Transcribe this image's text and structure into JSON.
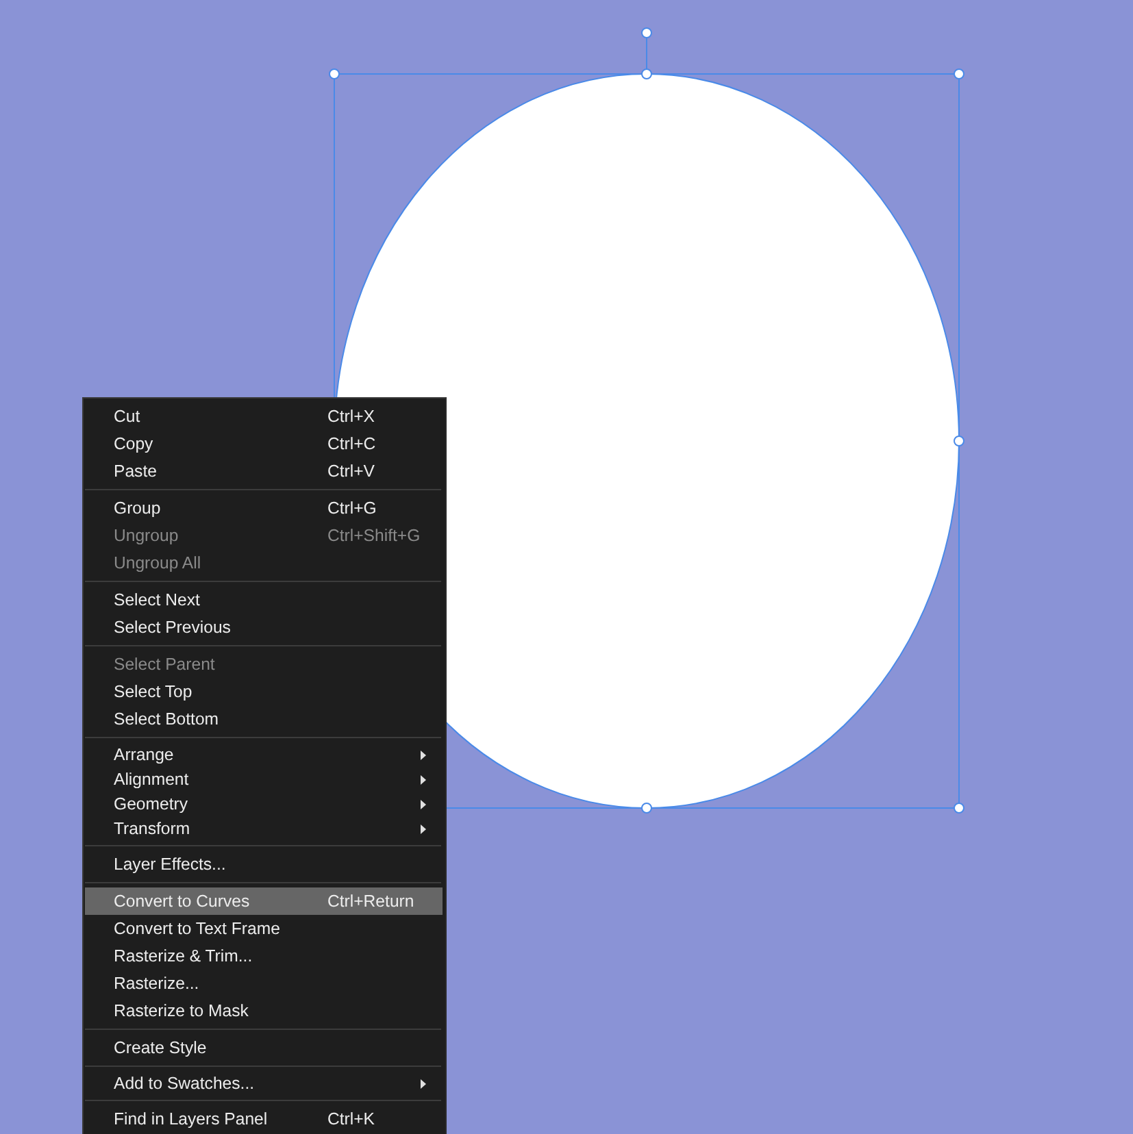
{
  "context_menu": {
    "sections": [
      {
        "items": [
          {
            "kind": "command",
            "label": "Cut",
            "shortcut": "Ctrl+X",
            "disabled": false,
            "selected": false
          },
          {
            "kind": "command",
            "label": "Copy",
            "shortcut": "Ctrl+C",
            "disabled": false,
            "selected": false
          },
          {
            "kind": "command",
            "label": "Paste",
            "shortcut": "Ctrl+V",
            "disabled": false,
            "selected": false
          }
        ]
      },
      {
        "items": [
          {
            "kind": "command",
            "label": "Group",
            "shortcut": "Ctrl+G",
            "disabled": false,
            "selected": false
          },
          {
            "kind": "command",
            "label": "Ungroup",
            "shortcut": "Ctrl+Shift+G",
            "disabled": true,
            "selected": false
          },
          {
            "kind": "command",
            "label": "Ungroup All",
            "disabled": true,
            "selected": false
          }
        ]
      },
      {
        "items": [
          {
            "kind": "command",
            "label": "Select Next",
            "disabled": false,
            "selected": false
          },
          {
            "kind": "command",
            "label": "Select Previous",
            "disabled": false,
            "selected": false
          }
        ]
      },
      {
        "items": [
          {
            "kind": "command",
            "label": "Select Parent",
            "disabled": true,
            "selected": false
          },
          {
            "kind": "command",
            "label": "Select Top",
            "disabled": false,
            "selected": false
          },
          {
            "kind": "command",
            "label": "Select Bottom",
            "disabled": false,
            "selected": false
          }
        ]
      },
      {
        "items": [
          {
            "kind": "submenu",
            "label": "Arrange",
            "disabled": false,
            "selected": false
          },
          {
            "kind": "submenu",
            "label": "Alignment",
            "disabled": false,
            "selected": false
          },
          {
            "kind": "submenu",
            "label": "Geometry",
            "disabled": false,
            "selected": false
          },
          {
            "kind": "submenu",
            "label": "Transform",
            "disabled": false,
            "selected": false
          }
        ]
      },
      {
        "items": [
          {
            "kind": "command",
            "label": "Layer Effects...",
            "disabled": false,
            "selected": false
          }
        ]
      },
      {
        "items": [
          {
            "kind": "command",
            "label": "Convert to Curves",
            "shortcut": "Ctrl+Return",
            "disabled": false,
            "selected": true
          },
          {
            "kind": "command",
            "label": "Convert to Text Frame",
            "disabled": false,
            "selected": false
          },
          {
            "kind": "command",
            "label": "Rasterize & Trim...",
            "disabled": false,
            "selected": false
          },
          {
            "kind": "command",
            "label": "Rasterize...",
            "disabled": false,
            "selected": false
          },
          {
            "kind": "command",
            "label": "Rasterize to Mask",
            "disabled": false,
            "selected": false
          }
        ]
      },
      {
        "items": [
          {
            "kind": "command",
            "label": "Create Style",
            "disabled": false,
            "selected": false
          }
        ]
      },
      {
        "items": [
          {
            "kind": "submenu",
            "label": "Add to Swatches...",
            "disabled": false,
            "selected": false
          }
        ]
      },
      {
        "items": [
          {
            "kind": "command",
            "label": "Find in Layers Panel",
            "shortcut": "Ctrl+K",
            "disabled": false,
            "selected": false
          }
        ]
      }
    ]
  }
}
